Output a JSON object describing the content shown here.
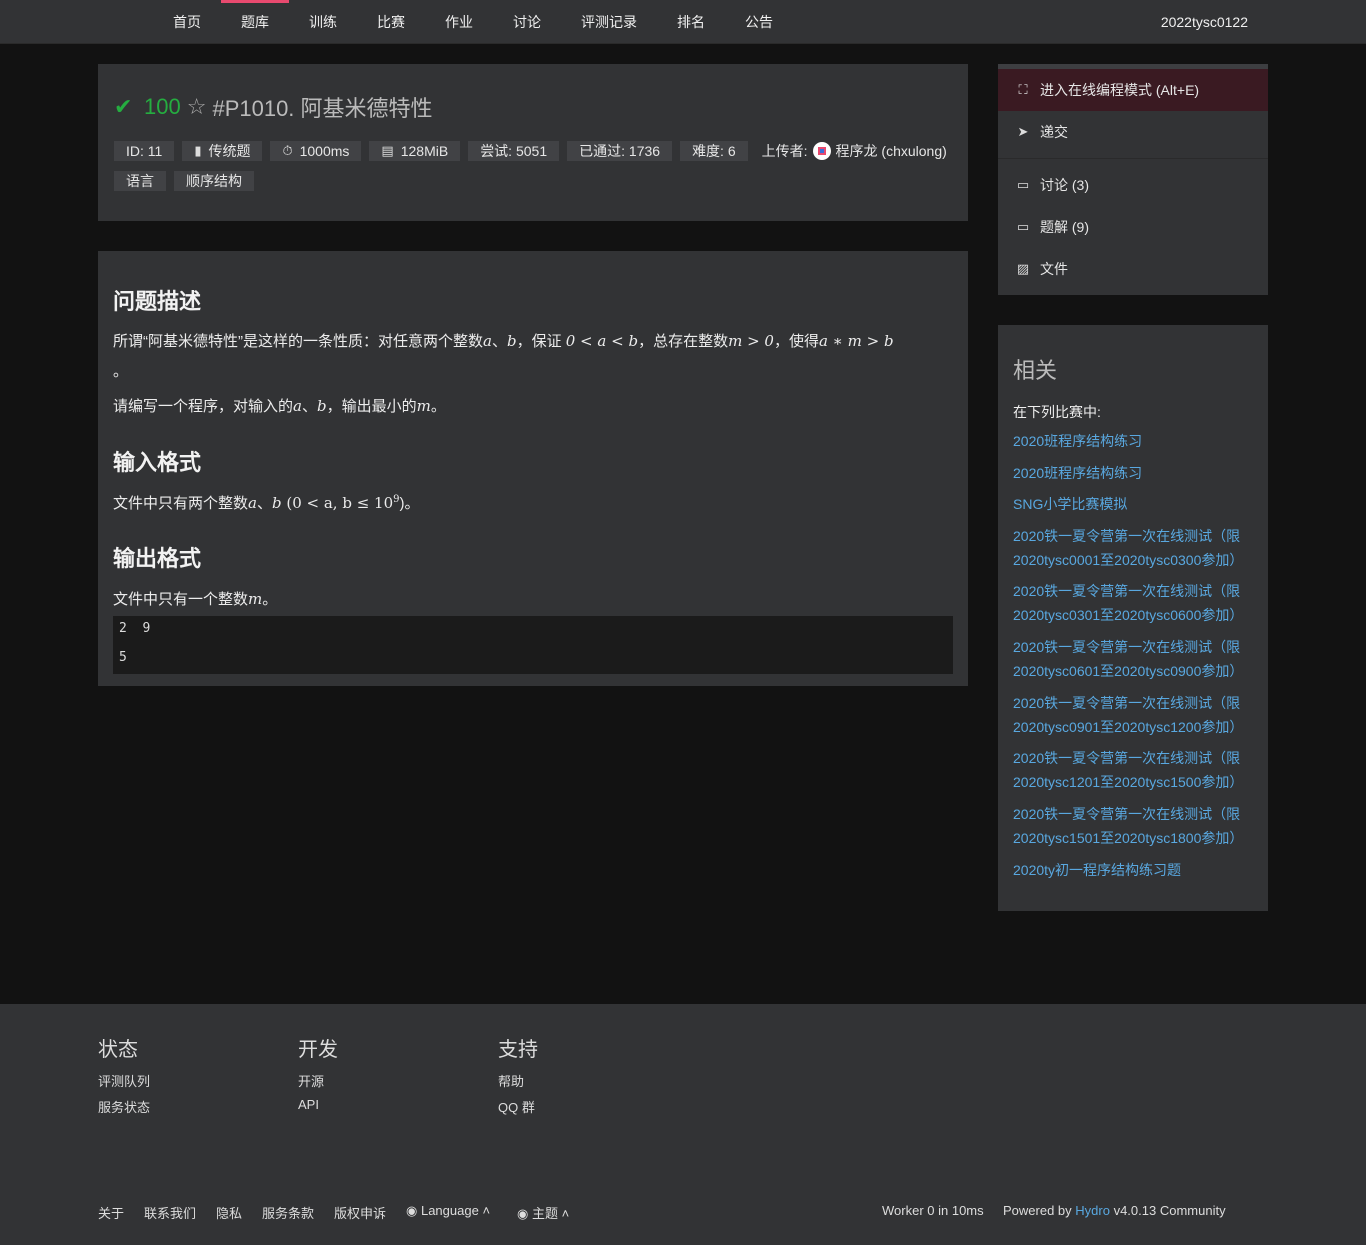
{
  "nav": {
    "items": [
      "首页",
      "题库",
      "训练",
      "比赛",
      "作业",
      "讨论",
      "评测记录",
      "排名",
      "公告"
    ],
    "active": "题库",
    "user": "2022tysc0122"
  },
  "problem": {
    "score": "100",
    "title": "#P1010. 阿基米德特性",
    "meta": {
      "id": "ID: 11",
      "type": "传统题",
      "time": "1000ms",
      "memory": "128MiB",
      "attempts": "尝试: 5051",
      "passed": "已通过: 1736",
      "difficulty": "难度: 6",
      "uploader_label": "上传者:",
      "uploader": "程序龙 (chxulong)"
    },
    "tags": [
      "语言",
      "顺序结构"
    ]
  },
  "content": {
    "desc_heading": "问题描述",
    "desc_line1_a": "所谓“阿基米德特性”是这样的一条性质：对任意两个整数",
    "desc_line1_math1": "a",
    "desc_line1_sep1": "、",
    "desc_line1_math2": "b",
    "desc_line1_b": "，保证 ",
    "desc_line1_math3": "0 < a < b",
    "desc_line1_c": "，总存在整数",
    "desc_line1_math4": "m > 0",
    "desc_line1_d": "，使得",
    "desc_line1_math5": "a ∗ m > b",
    "desc_line2": "。",
    "desc_line3_a": "请编写一个程序，对输入的",
    "desc_line3_math1": "a",
    "desc_line3_sep": "、",
    "desc_line3_math2": "b",
    "desc_line3_b": "，输出最小的",
    "desc_line3_math3": "m",
    "desc_line3_c": "。",
    "input_heading": "输入格式",
    "input_a": "文件中只有两个整数",
    "input_math1": "a",
    "input_sep": "、",
    "input_math2": "b",
    "input_math3": " (0 < a, b ≤ 10",
    "input_sup": "9",
    "input_b": ")。",
    "output_heading": "输出格式",
    "output_a": "文件中只有一个整数",
    "output_math": "m",
    "output_b": "。",
    "sample_input": "2  9",
    "sample_output": "5"
  },
  "sidebar": {
    "ide": "进入在线编程模式 (Alt+E)",
    "submit": "递交",
    "discuss": "讨论 (3)",
    "solutions": "题解 (9)",
    "files": "文件"
  },
  "related": {
    "title": "相关",
    "subtitle": "在下列比赛中:",
    "links": [
      "2020班程序结构练习",
      "2020班程序结构练习",
      "SNG小学比赛模拟",
      "2020铁一夏令营第一次在线测试（限2020tysc0001至2020tysc0300参加）",
      "2020铁一夏令营第一次在线测试（限2020tysc0301至2020tysc0600参加）",
      "2020铁一夏令营第一次在线测试（限2020tysc0601至2020tysc0900参加）",
      "2020铁一夏令营第一次在线测试（限2020tysc0901至2020tysc1200参加）",
      "2020铁一夏令营第一次在线测试（限2020tysc1201至2020tysc1500参加）",
      "2020铁一夏令营第一次在线测试（限2020tysc1501至2020tysc1800参加）",
      "2020ty初一程序结构练习题"
    ]
  },
  "footer": {
    "col1_title": "状态",
    "col1_links": [
      "评测队列",
      "服务状态"
    ],
    "col2_title": "开发",
    "col2_links": [
      "开源",
      "API"
    ],
    "col3_title": "支持",
    "col3_links": [
      "帮助",
      "QQ 群"
    ],
    "bottom_links": [
      "关于",
      "联系我们",
      "隐私",
      "服务条款",
      "版权申诉"
    ],
    "language": "Language",
    "theme": "主题",
    "worker": "Worker 0 in 10ms",
    "powered_a": "Powered by ",
    "powered_hydro": "Hydro",
    "powered_b": " v4.0.13 ",
    "powered_c": "Community"
  },
  "colors": {
    "accent": "#e84a6f",
    "success": "#25ad40",
    "link": "#59a8e0",
    "panel": "#323335",
    "background": "#121212"
  }
}
